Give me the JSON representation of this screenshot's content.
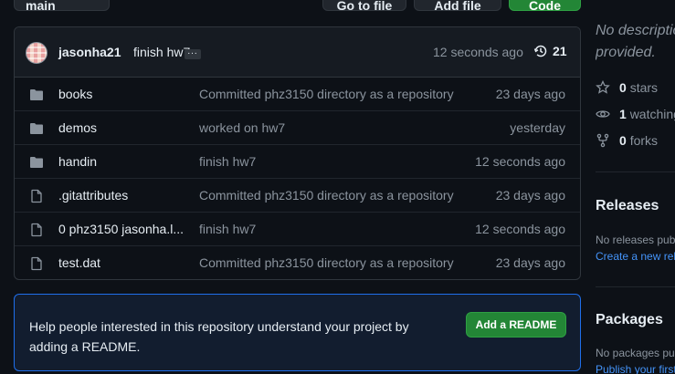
{
  "toolbar": {
    "branch_label": "main",
    "goto_label": "Go to file",
    "add_label": "Add file",
    "code_label": "Code"
  },
  "commit": {
    "author": "jasonha21",
    "message": "finish hw7",
    "ellipsis": "...",
    "time": "12 seconds ago",
    "history_count": "21"
  },
  "files": [
    {
      "name": "books",
      "type": "folder",
      "message": "Committed phz3150 directory as a repository",
      "age": "23 days ago"
    },
    {
      "name": "demos",
      "type": "folder",
      "message": "worked on hw7",
      "age": "yesterday"
    },
    {
      "name": "handin",
      "type": "folder",
      "message": "finish hw7",
      "age": "12 seconds ago"
    },
    {
      "name": ".gitattributes",
      "type": "file",
      "message": "Committed phz3150 directory as a repository",
      "age": "23 days ago"
    },
    {
      "name": "0 phz3150 jasonha.l...",
      "type": "file",
      "message": "finish hw7",
      "age": "12 seconds ago"
    },
    {
      "name": "test.dat",
      "type": "file",
      "message": "Committed phz3150 directory as a repository",
      "age": "23 days ago"
    }
  ],
  "readme": {
    "text": "Help people interested in this repository understand your project by adding a README.",
    "button_label": "Add a README"
  },
  "sidebar": {
    "about_line1": "No descriptio",
    "about_line2": "provided.",
    "stars_count": "0",
    "stars_label": "stars",
    "watching_count": "1",
    "watching_label": "watching",
    "forks_count": "0",
    "forks_label": "forks",
    "releases_heading": "Releases",
    "releases_text": "No releases publ",
    "releases_link": "Create a new rele",
    "packages_heading": "Packages",
    "packages_text": "No packages pub",
    "packages_link": "Publish your first"
  },
  "colors": {
    "background": "#0d1117",
    "accent_green": "#238636",
    "link_blue": "#4493f8",
    "muted": "#8b949e"
  }
}
